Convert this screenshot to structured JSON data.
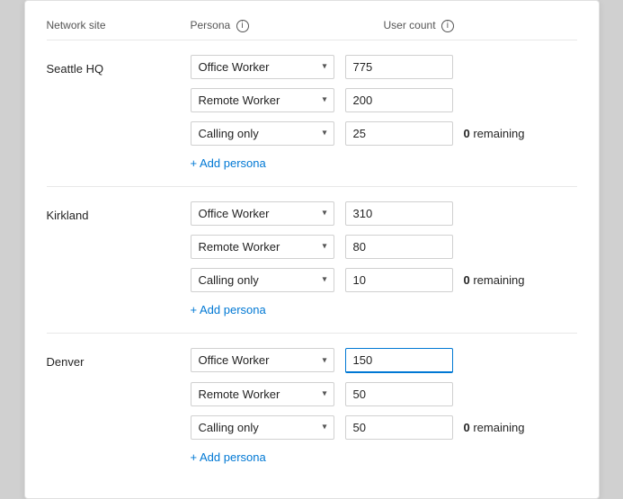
{
  "header": {
    "network_site_label": "Network site",
    "persona_label": "Persona",
    "user_count_label": "User count"
  },
  "sites": [
    {
      "name": "Seattle HQ",
      "personas": [
        {
          "id": "office-worker",
          "label": "Office Worker",
          "count": "775",
          "show_remaining": false,
          "remaining": null,
          "active": false
        },
        {
          "id": "remote-worker",
          "label": "Remote Worker",
          "count": "200",
          "show_remaining": false,
          "remaining": null,
          "active": false
        },
        {
          "id": "calling-only",
          "label": "Calling only",
          "count": "25",
          "show_remaining": true,
          "remaining": "0 remaining",
          "zero": "0",
          "rest": " remaining",
          "active": false
        }
      ],
      "add_label": "+ Add persona"
    },
    {
      "name": "Kirkland",
      "personas": [
        {
          "id": "office-worker",
          "label": "Office Worker",
          "count": "310",
          "show_remaining": false,
          "remaining": null,
          "active": false
        },
        {
          "id": "remote-worker",
          "label": "Remote Worker",
          "count": "80",
          "show_remaining": false,
          "remaining": null,
          "active": false
        },
        {
          "id": "calling-only",
          "label": "Calling only",
          "count": "10",
          "show_remaining": true,
          "remaining": "0 remaining",
          "zero": "0",
          "rest": " remaining",
          "active": false
        }
      ],
      "add_label": "+ Add persona"
    },
    {
      "name": "Denver",
      "personas": [
        {
          "id": "office-worker",
          "label": "Office Worker",
          "count": "150",
          "show_remaining": false,
          "remaining": null,
          "active": true
        },
        {
          "id": "remote-worker",
          "label": "Remote Worker",
          "count": "50",
          "show_remaining": false,
          "remaining": null,
          "active": false
        },
        {
          "id": "calling-only",
          "label": "Calling only",
          "count": "50",
          "show_remaining": true,
          "remaining": "0 remaining",
          "zero": "0",
          "rest": " remaining",
          "active": false
        }
      ],
      "add_label": "+ Add persona"
    }
  ],
  "persona_options": [
    "Office Worker",
    "Remote Worker",
    "Calling only"
  ],
  "icons": {
    "info": "i",
    "chevron_down": "▾"
  }
}
